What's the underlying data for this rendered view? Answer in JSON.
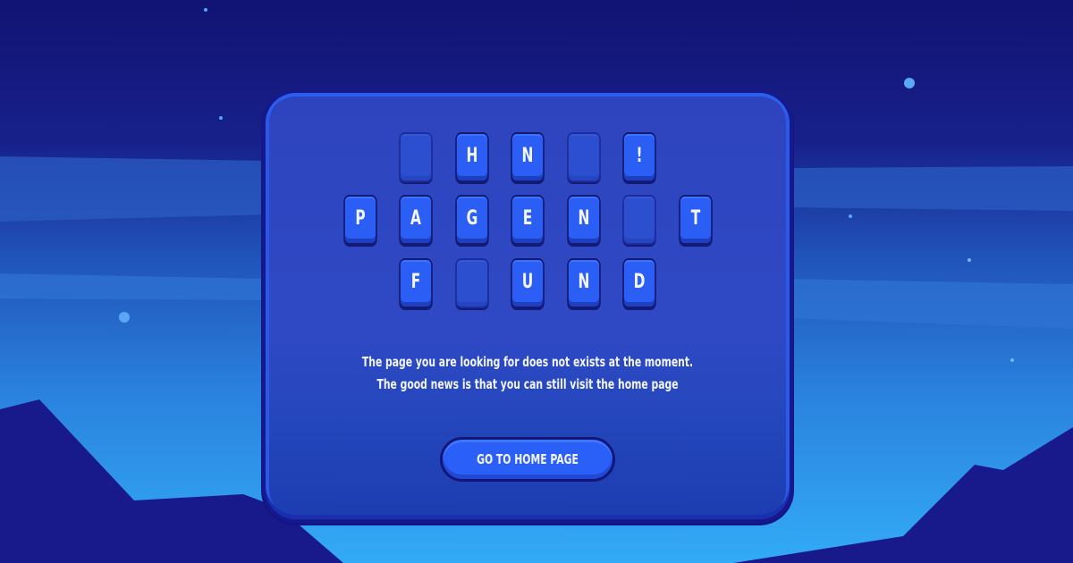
{
  "page": {
    "background_top": "#121373",
    "background_bottom": "#33a9f4",
    "card_color": "#2f47c2",
    "tile_color": "#2a5ef5",
    "accent_dark": "#141a72"
  },
  "puzzle": {
    "rows": [
      [
        "",
        "H",
        "N",
        "",
        "!"
      ],
      [
        "P",
        "A",
        "G",
        "E",
        "N",
        "",
        "T"
      ],
      [
        "F",
        "",
        "U",
        "N",
        "D"
      ]
    ]
  },
  "message": {
    "line1": "The page you are looking for does not exists at the moment.",
    "line2": "The good news is that you can still visit the home page"
  },
  "actions": {
    "home_label": "GO TO HOME PAGE"
  }
}
